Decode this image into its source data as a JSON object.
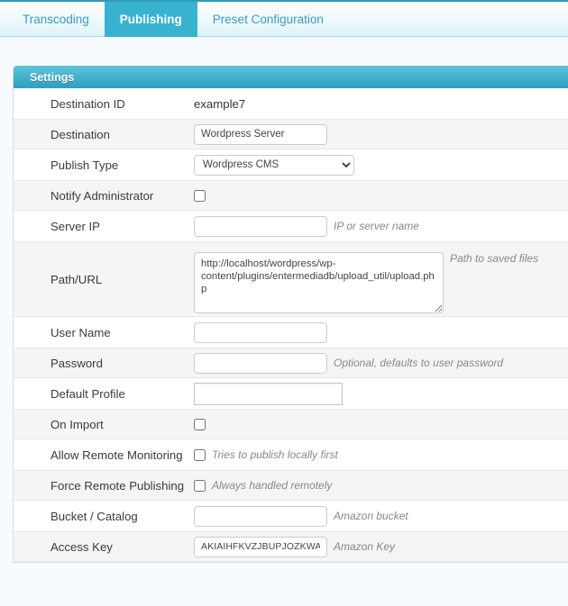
{
  "tabs": [
    {
      "label": "Transcoding",
      "active": false
    },
    {
      "label": "Publishing",
      "active": true
    },
    {
      "label": "Preset Configuration",
      "active": false
    }
  ],
  "panel": {
    "title": "Settings"
  },
  "form": {
    "destination_id": {
      "label": "Destination ID",
      "value": "example7"
    },
    "destination": {
      "label": "Destination",
      "value": "Wordpress Server"
    },
    "publish_type": {
      "label": "Publish Type",
      "selected": "Wordpress CMS"
    },
    "notify_administrator": {
      "label": "Notify Administrator",
      "checked": false
    },
    "server_ip": {
      "label": "Server IP",
      "value": "",
      "hint": "IP or server name"
    },
    "path_url": {
      "label": "Path/URL",
      "value": "http://localhost/wordpress/wp-content/plugins/entermediadb/upload_util/upload.php",
      "hint": "Path to saved files"
    },
    "user_name": {
      "label": "User Name",
      "value": ""
    },
    "password": {
      "label": "Password",
      "value": "",
      "hint": "Optional, defaults to user password"
    },
    "default_profile": {
      "label": "Default Profile",
      "value": ""
    },
    "on_import": {
      "label": "On Import",
      "checked": false
    },
    "allow_remote_monitoring": {
      "label": "Allow Remote Monitoring",
      "checked": false,
      "hint": "Tries to publish locally first"
    },
    "force_remote_publishing": {
      "label": "Force Remote Publishing",
      "checked": false,
      "hint": "Always handled remotely"
    },
    "bucket_catalog": {
      "label": "Bucket / Catalog",
      "value": "",
      "hint": "Amazon bucket"
    },
    "access_key": {
      "label": "Access Key",
      "value": "AKIAIHFKVZJBUPJOZKWA",
      "hint": "Amazon Key"
    }
  },
  "colors": {
    "accent": "#37b3cf",
    "tab_text": "#3a9cba",
    "panel_header_start": "#5ec3dc",
    "panel_header_end": "#2f9fc0",
    "page_background": "#f8fbfd",
    "stripe": "#f5f5f5"
  }
}
